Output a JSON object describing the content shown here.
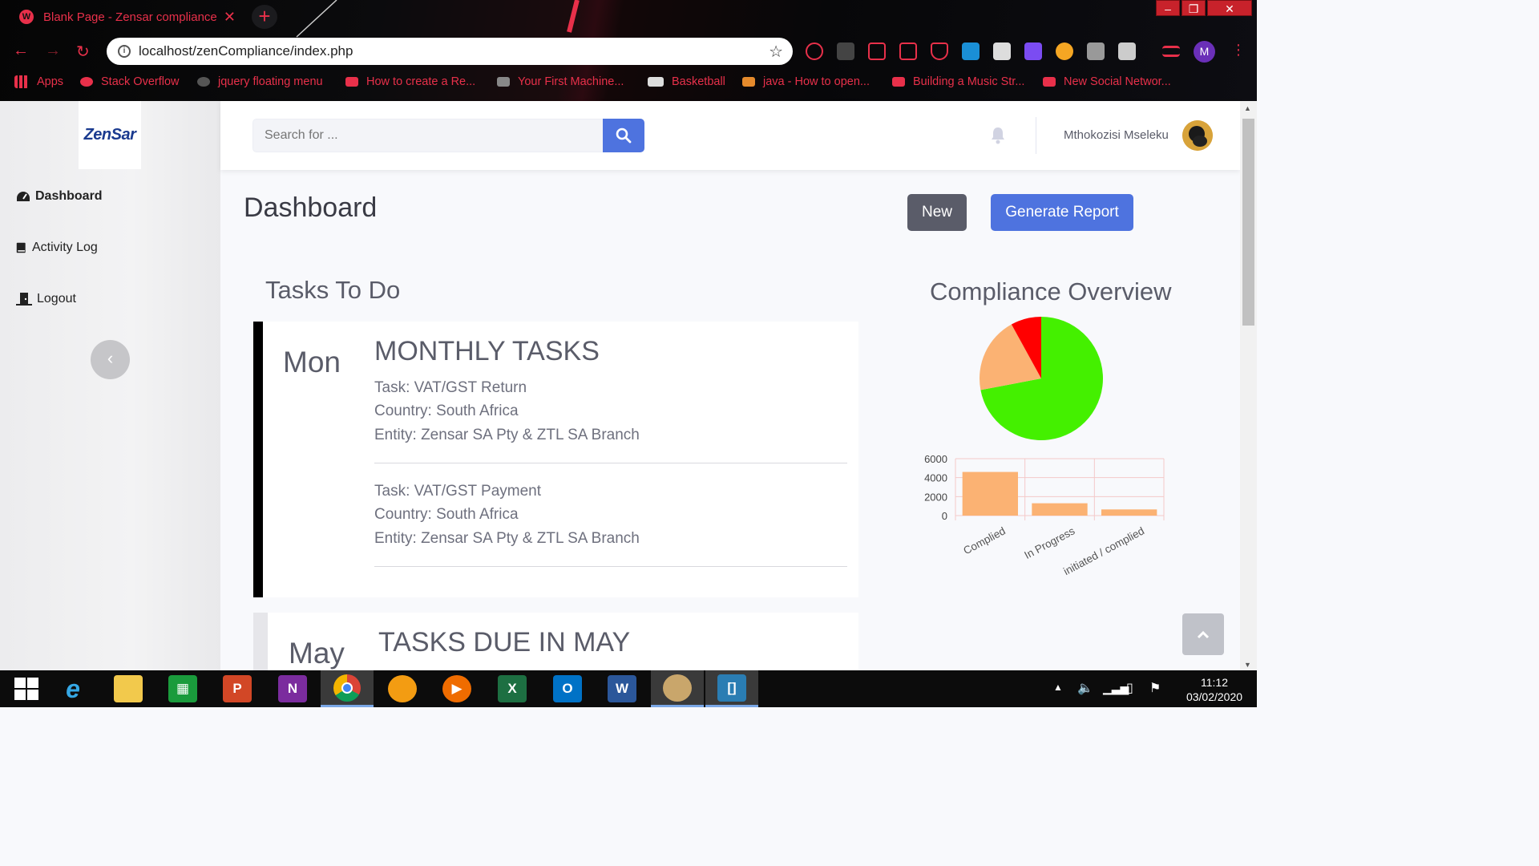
{
  "browser": {
    "tab_title": "Blank Page - Zensar compliance",
    "url": "localhost/zenCompliance/index.php",
    "profile_initial": "M",
    "bookmarks": [
      "Apps",
      "Stack Overflow",
      "jquery floating menu",
      "How to create a Re...",
      "Your First Machine...",
      "Basketball",
      "java - How to open...",
      "Building a Music Str...",
      "New Social Networ..."
    ]
  },
  "sidebar": {
    "logo_text": "ZenSar",
    "items": [
      {
        "label": "Dashboard",
        "icon": "tachometer-icon",
        "active": true
      },
      {
        "label": "Activity Log",
        "icon": "book-icon",
        "active": false
      },
      {
        "label": "Logout",
        "icon": "door-icon",
        "active": false
      }
    ],
    "collapse_glyph": "‹"
  },
  "topbar": {
    "search_placeholder": "Search for ...",
    "username": "Mthokozisi Mseleku"
  },
  "main": {
    "title": "Dashboard",
    "new_button": "New",
    "report_button": "Generate Report",
    "tasks_heading": "Tasks To Do",
    "overview_heading": "Compliance Overview",
    "cards": [
      {
        "day": "Mon",
        "title": "MONTHLY TASKS",
        "tasks": [
          {
            "task": "Task: VAT/GST Return",
            "country": "Country: South Africa",
            "entity": "Entity: Zensar SA Pty & ZTL SA Branch"
          },
          {
            "task": "Task: VAT/GST Payment",
            "country": "Country: South Africa",
            "entity": "Entity: Zensar SA Pty & ZTL SA Branch"
          }
        ]
      },
      {
        "day": "May",
        "title": "TASKS DUE IN MAY",
        "tasks": []
      }
    ]
  },
  "chart_data": [
    {
      "type": "pie",
      "slices": [
        {
          "label": "Complied",
          "value": 72,
          "color": "#44f000"
        },
        {
          "label": "In Progress",
          "value": 20,
          "color": "#fbb273"
        },
        {
          "label": "initiated / complied",
          "value": 8,
          "color": "#ff0000"
        }
      ]
    },
    {
      "type": "bar",
      "categories": [
        "Complied",
        "In Progress",
        "initiated / complied"
      ],
      "values": [
        4600,
        1300,
        650
      ],
      "color": "#fbb273",
      "ylim": [
        0,
        6000
      ],
      "yticks": [
        "6000",
        "4000",
        "2000",
        "0"
      ],
      "grid": true
    }
  ],
  "taskbar": {
    "time": "11:12",
    "date": "03/02/2020",
    "apps": [
      "windows-start",
      "internet-explorer",
      "file-explorer",
      "microsoft-store",
      "powerpoint",
      "onenote",
      "chrome",
      "fl-studio",
      "media-player",
      "excel",
      "outlook",
      "word",
      "paint",
      "app-launcher"
    ]
  },
  "colors": {
    "primary": "#4e73df",
    "secondary": "#5a5c69",
    "accent_red": "#e8304a"
  }
}
